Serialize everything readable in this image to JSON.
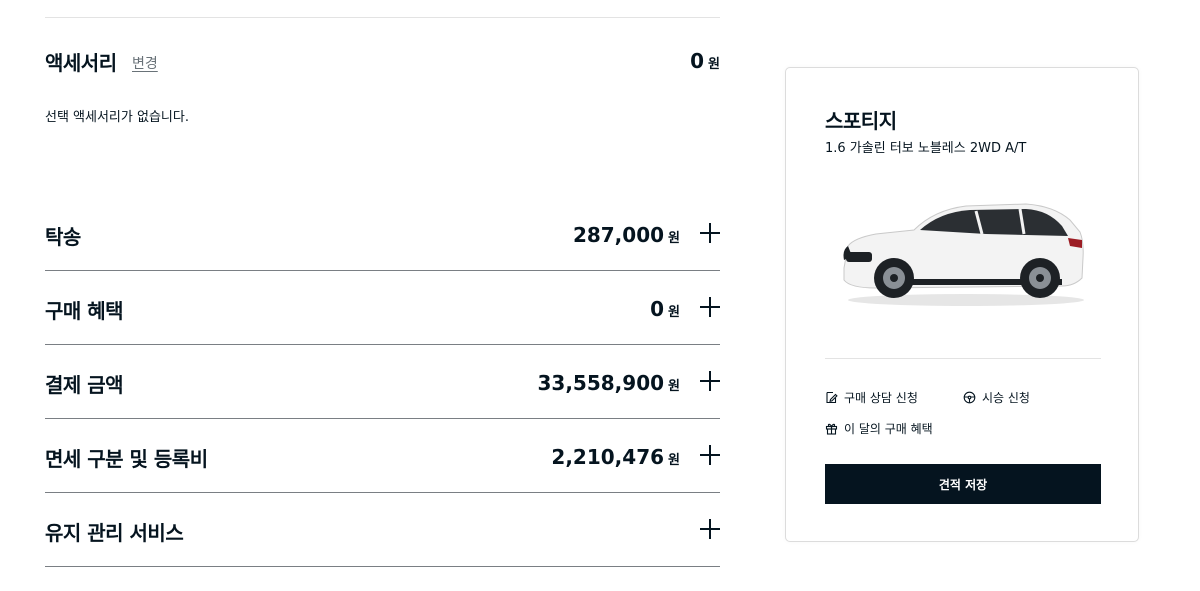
{
  "accessory": {
    "title": "액세서리",
    "change_label": "변경",
    "amount": "0",
    "currency": "원",
    "empty_message": "선택 액세서리가 없습니다."
  },
  "rows": [
    {
      "title": "탁송",
      "amount": "287,000",
      "currency": "원"
    },
    {
      "title": "구매 혜택",
      "amount": "0",
      "currency": "원"
    },
    {
      "title": "결제 금액",
      "amount": "33,558,900",
      "currency": "원"
    },
    {
      "title": "면세 구분 및 등록비",
      "amount": "2,210,476",
      "currency": "원"
    },
    {
      "title": "유지 관리 서비스"
    }
  ],
  "summary": {
    "model": "스포티지",
    "trim": "1.6 가솔린 터보 노블레스 2WD A/T",
    "links": {
      "consult": "구매 상담 신청",
      "test_drive": "시승 신청",
      "monthly_benefit": "이 달의 구매 혜택"
    },
    "save_button": "견적 저장"
  },
  "colors": {
    "primary": "#05141f",
    "muted": "#697278",
    "divider": "#7a7f84"
  },
  "icons": [
    "pen-icon",
    "steering-wheel-icon",
    "gift-icon",
    "plus-icon"
  ]
}
